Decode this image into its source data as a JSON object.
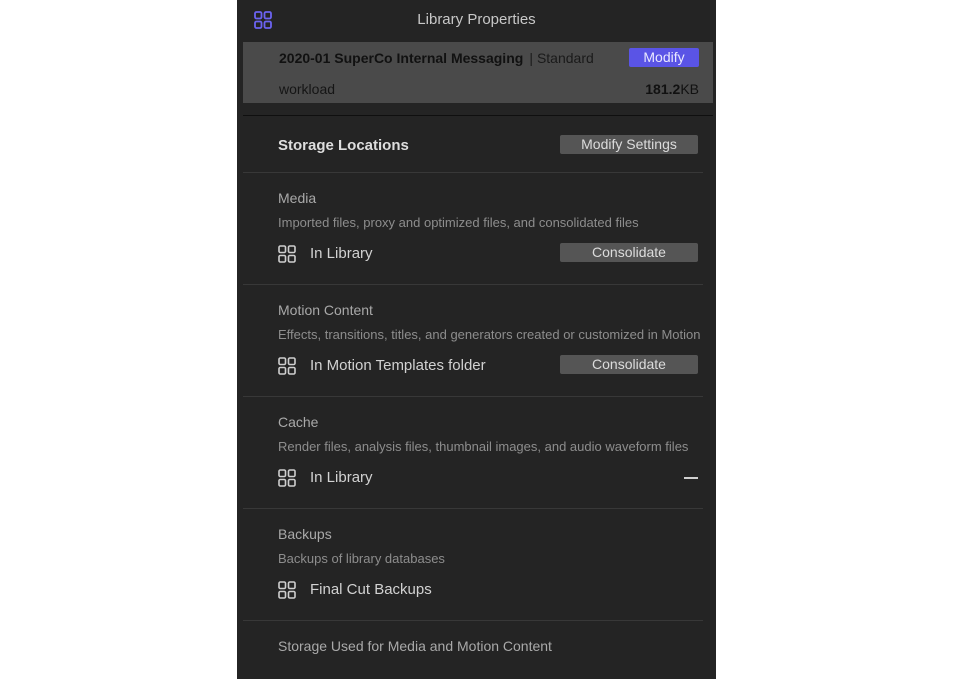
{
  "window": {
    "title": "Library Properties",
    "app_icon": "grid-icon"
  },
  "library": {
    "name": "2020-01 SuperCo Internal Messaging",
    "separator": "|",
    "type": "Standard",
    "modify_label": "Modify",
    "workload_label": "workload",
    "size_value": "181.2",
    "size_unit": "KB"
  },
  "storage": {
    "title": "Storage Locations",
    "modify_settings_label": "Modify Settings"
  },
  "sections": {
    "media": {
      "title": "Media",
      "description": "Imported files, proxy and optimized files, and consolidated files",
      "location": "In Library",
      "location_icon": "location-grid-icon",
      "action_label": "Consolidate"
    },
    "motion": {
      "title": "Motion Content",
      "description": "Effects, transitions, titles, and generators created or customized in Motion",
      "location": "In Motion Templates folder",
      "location_icon": "location-grid-icon",
      "action_label": "Consolidate"
    },
    "cache": {
      "title": "Cache",
      "description": "Render files, analysis files, thumbnail images, and audio waveform files",
      "location": "In Library",
      "location_icon": "location-grid-icon"
    },
    "backups": {
      "title": "Backups",
      "description": "Backups of library databases",
      "location": "Final Cut Backups",
      "location_icon": "location-grid-icon"
    },
    "storage_used": {
      "title": "Storage Used for Media and Motion Content"
    }
  },
  "colors": {
    "panel_bg": "#242424",
    "accent": "#5a54e6",
    "info_band_bg": "#4a4a4a",
    "button_bg": "#555555"
  }
}
